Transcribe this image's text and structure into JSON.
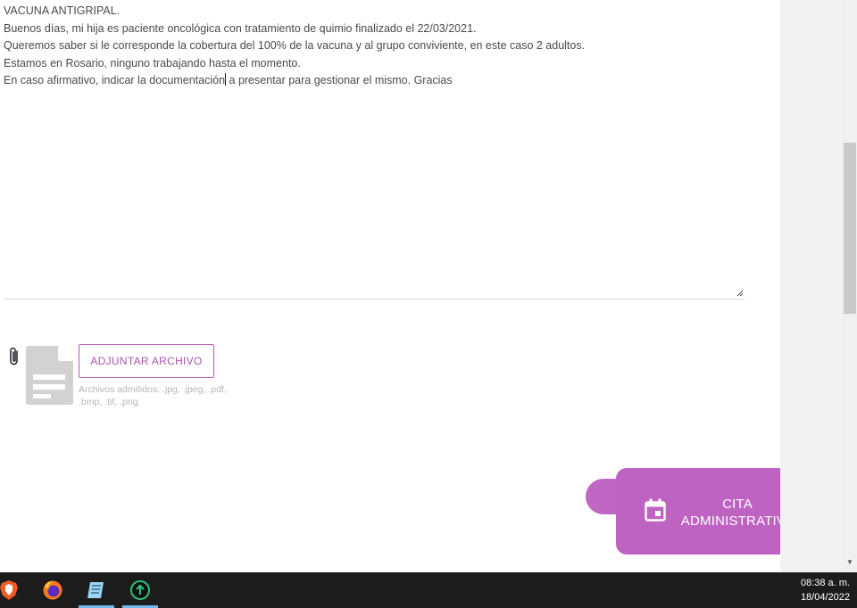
{
  "message": {
    "lines": [
      "VACUNA ANTIGRIPAL.",
      "Buenos días, mi hija es paciente oncológica con tratamiento de quimio finalizado el 22/03/2021.",
      "Queremos saber si le corresponde la cobertura del 100% de la vacuna y al grupo conviviente, en este caso 2 adultos.",
      "Estamos en Rosario, ninguno trabajando hasta el momento."
    ],
    "last_line_before_caret": "En caso afirmativo, indicar la documentación",
    "last_line_after_caret": " a presentar para gestionar el mismo. Gracias"
  },
  "attachment": {
    "button_label": "ADJUNTAR ARCHIVO",
    "note": "Archivos admitidos: .jpg, .jpeg, .pdf, .bmp, .tif, .png."
  },
  "cita_button": {
    "line1": "CITA",
    "line2": "ADMINISTRATIVA"
  },
  "taskbar": {
    "icons": [
      "brave-browser-icon",
      "firefox-icon",
      "notepad-icon",
      "update-icon"
    ],
    "time": "08:38 a. m.",
    "date": "18/04/2022"
  },
  "colors": {
    "accent": "#bf63c3",
    "accent_border": "#b05fb0",
    "taskbar": "#1c1c1c"
  }
}
